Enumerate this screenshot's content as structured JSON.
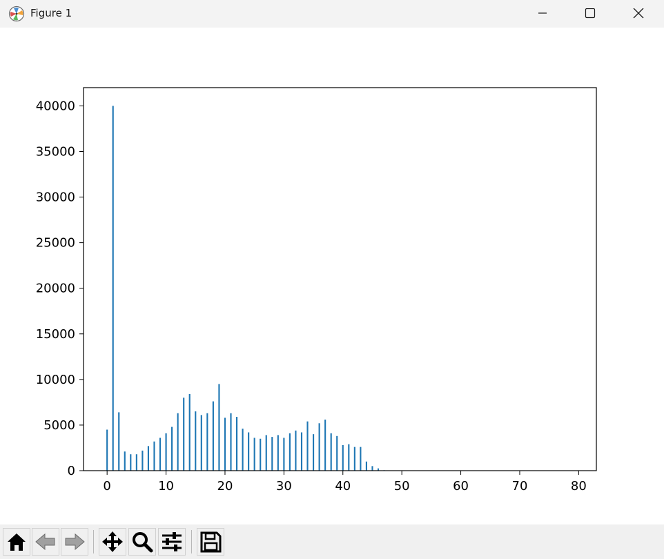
{
  "window": {
    "title": "Figure 1",
    "minimize_label": "Minimize",
    "maximize_label": "Maximize",
    "close_label": "Close"
  },
  "toolbar": {
    "buttons": [
      {
        "icon": "home-icon",
        "label": "Home"
      },
      {
        "icon": "back-arrow-icon",
        "label": "Back"
      },
      {
        "icon": "forward-arrow-icon",
        "label": "Forward"
      },
      {
        "icon": "pan-move-icon",
        "label": "Pan"
      },
      {
        "icon": "zoom-magnifier-icon",
        "label": "Zoom"
      },
      {
        "icon": "configure-subplots-icon",
        "label": "Subplots"
      },
      {
        "icon": "save-disk-icon",
        "label": "Save"
      }
    ]
  },
  "chart_data": {
    "type": "bar",
    "title": "",
    "xlabel": "",
    "ylabel": "",
    "xlim": [
      -4,
      83
    ],
    "ylim": [
      0,
      42000
    ],
    "xticks": [
      0,
      10,
      20,
      30,
      40,
      50,
      60,
      70,
      80
    ],
    "yticks": [
      0,
      5000,
      10000,
      15000,
      20000,
      25000,
      30000,
      35000,
      40000
    ],
    "grid": false,
    "bar_color": "#1f77b4",
    "x": [
      0,
      1,
      2,
      3,
      4,
      5,
      6,
      7,
      8,
      9,
      10,
      11,
      12,
      13,
      14,
      15,
      16,
      17,
      18,
      19,
      20,
      21,
      22,
      23,
      24,
      25,
      26,
      27,
      28,
      29,
      30,
      31,
      32,
      33,
      34,
      35,
      36,
      37,
      38,
      39,
      40,
      41,
      42,
      43,
      44,
      45,
      46,
      47,
      48,
      49,
      50
    ],
    "values": [
      4500,
      40000,
      6400,
      2100,
      1800,
      1800,
      2200,
      2700,
      3200,
      3600,
      4100,
      4800,
      6300,
      8000,
      8400,
      6500,
      6100,
      6300,
      7600,
      9500,
      5800,
      6300,
      5900,
      4600,
      4200,
      3600,
      3500,
      3900,
      3700,
      3900,
      3600,
      4100,
      4400,
      4200,
      5400,
      4000,
      5200,
      5600,
      4100,
      3800,
      2800,
      2900,
      2600,
      2600,
      1000,
      500,
      250,
      50,
      20,
      10,
      5
    ]
  }
}
